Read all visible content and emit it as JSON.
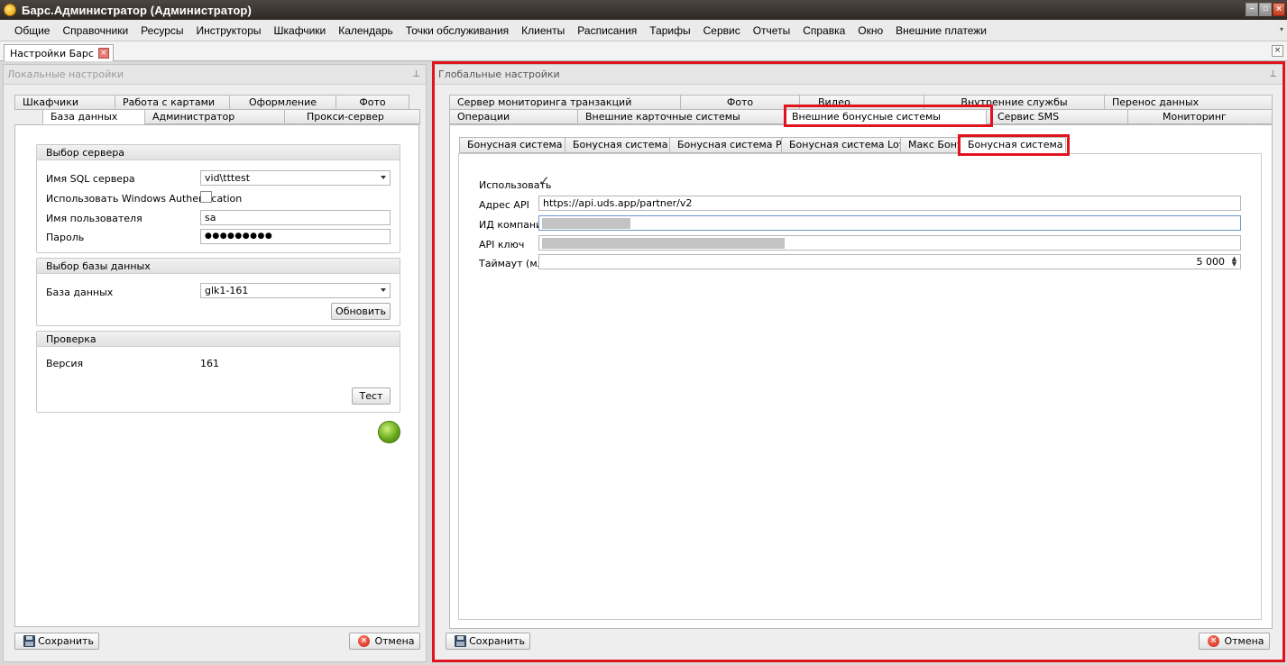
{
  "window": {
    "title": "Барс.Администратор (Администратор)"
  },
  "menu": [
    "Общие",
    "Справочники",
    "Ресурсы",
    "Инструкторы",
    "Шкафчики",
    "Календарь",
    "Точки обслуживания",
    "Клиенты",
    "Расписания",
    "Тарифы",
    "Сервис",
    "Отчеты",
    "Справка",
    "Окно",
    "Внешние платежи"
  ],
  "doc_tab": {
    "label": "Настройки Барс"
  },
  "local": {
    "header": "Локальные настройки",
    "tabs_row1": [
      "Шкафчики",
      "Работа с картами",
      "Оформление",
      "Фото"
    ],
    "tabs_row2": [
      "База данных",
      "Администратор",
      "Прокси-сервер"
    ],
    "server_group": {
      "title": "Выбор сервера",
      "sql_label": "Имя SQL сервера",
      "sql_value": "vid\\tttest",
      "winauth_label": "Использовать Windows Authentication",
      "user_label": "Имя пользователя",
      "user_value": "sa",
      "password_label": "Пароль",
      "password_value": "●●●●●●●●●"
    },
    "db_group": {
      "title": "Выбор базы данных",
      "db_label": "База данных",
      "db_value": "glk1-161",
      "refresh_button": "Обновить"
    },
    "check_group": {
      "title": "Проверка",
      "version_label": "Версия",
      "version_value": "161",
      "test_button": "Тест"
    },
    "save_button": "Сохранить",
    "cancel_button": "Отмена"
  },
  "global": {
    "header": "Глобальные настройки",
    "tabs_row1": [
      "Сервер мониторинга транзакций",
      "Фото",
      "Видео",
      "Внутренние службы",
      "Перенос данных"
    ],
    "tabs_row2": [
      "Операции",
      "Внешние карточные системы",
      "Внешние бонусные системы",
      "Сервис SMS",
      "Мониторинг"
    ],
    "subtabs": [
      "Бонусная система TNG",
      "Бонусная система LSC",
      "Бонусная система Рарус",
      "Бонусная система Loymax",
      "Макс Бонус",
      "Бонусная система UDS"
    ],
    "form": {
      "use_label": "Использовать",
      "use_checked": true,
      "api_label": "Адрес API",
      "api_value": "https://api.uds.app/partner/v2",
      "company_label": "ИД компании",
      "key_label": "API ключ",
      "timeout_label": "Таймаут (млс)",
      "timeout_value": "5 000"
    },
    "save_button": "Сохранить",
    "cancel_button": "Отмена"
  },
  "colors": {
    "highlight": "#e0141e",
    "led": "#6aa91c"
  }
}
